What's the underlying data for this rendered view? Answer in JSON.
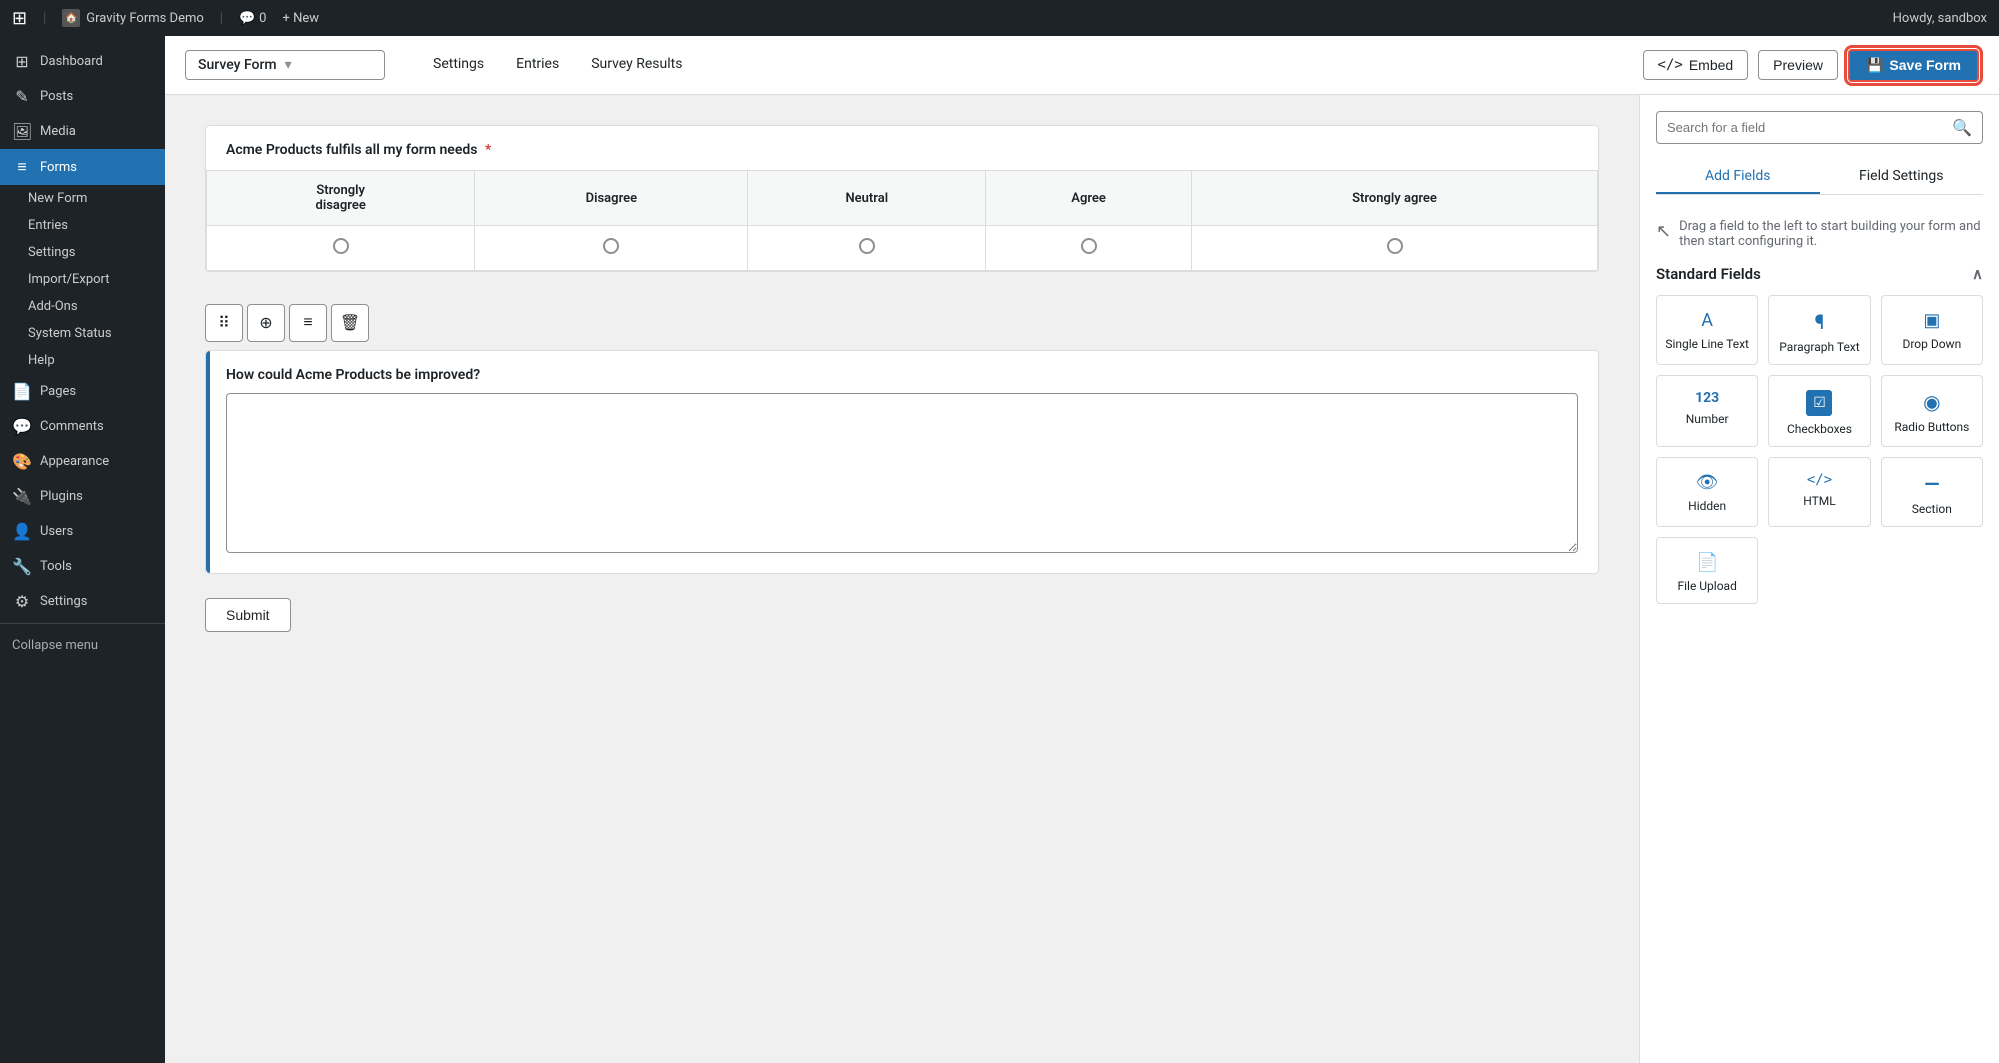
{
  "topbar": {
    "logo": "W",
    "site_name": "Gravity Forms Demo",
    "comments_count": "0",
    "new_label": "+ New",
    "greeting": "Howdy, sandbox"
  },
  "sidebar": {
    "items": [
      {
        "id": "dashboard",
        "label": "Dashboard",
        "icon": "⊞"
      },
      {
        "id": "posts",
        "label": "Posts",
        "icon": "✎"
      },
      {
        "id": "media",
        "label": "Media",
        "icon": "🖼"
      },
      {
        "id": "forms",
        "label": "Forms",
        "icon": "≡",
        "active": true
      },
      {
        "id": "pages",
        "label": "Pages",
        "icon": "📄"
      },
      {
        "id": "comments",
        "label": "Comments",
        "icon": "💬"
      },
      {
        "id": "appearance",
        "label": "Appearance",
        "icon": "🎨"
      },
      {
        "id": "plugins",
        "label": "Plugins",
        "icon": "🔌"
      },
      {
        "id": "users",
        "label": "Users",
        "icon": "👤"
      },
      {
        "id": "tools",
        "label": "Tools",
        "icon": "🔧"
      },
      {
        "id": "settings",
        "label": "Settings",
        "icon": "⚙"
      }
    ],
    "submenu_forms": [
      {
        "id": "new-form",
        "label": "New Form"
      },
      {
        "id": "entries",
        "label": "Entries"
      },
      {
        "id": "settings",
        "label": "Settings"
      },
      {
        "id": "import-export",
        "label": "Import/Export"
      },
      {
        "id": "add-ons",
        "label": "Add-Ons"
      },
      {
        "id": "system-status",
        "label": "System Status"
      },
      {
        "id": "help",
        "label": "Help"
      }
    ],
    "collapse_label": "Collapse menu"
  },
  "subheader": {
    "form_title": "Survey Form",
    "nav_items": [
      {
        "id": "settings",
        "label": "Settings"
      },
      {
        "id": "entries",
        "label": "Entries"
      },
      {
        "id": "survey-results",
        "label": "Survey Results"
      }
    ],
    "embed_label": "Embed",
    "preview_label": "Preview",
    "save_label": "Save Form"
  },
  "form_editor": {
    "question1": {
      "label": "Acme Products fulfils all my form needs",
      "required": true,
      "columns": [
        "Strongly disagree",
        "Disagree",
        "Neutral",
        "Agree",
        "Strongly agree"
      ]
    },
    "question2": {
      "label": "How could Acme Products be improved?",
      "placeholder": ""
    },
    "submit_label": "Submit",
    "toolbar": {
      "move_icon": "⋮⋮",
      "duplicate_icon": "⊕",
      "settings_icon": "≡",
      "delete_icon": "🗑"
    }
  },
  "right_panel": {
    "search_placeholder": "Search for a field",
    "tabs": [
      {
        "id": "add-fields",
        "label": "Add Fields",
        "active": true
      },
      {
        "id": "field-settings",
        "label": "Field Settings",
        "active": false
      }
    ],
    "drag_hint": "Drag a field to the left to start building your form and then start configuring it.",
    "standard_fields_label": "Standard Fields",
    "fields": [
      {
        "id": "single-line-text",
        "label": "Single Line Text",
        "icon": "A↕"
      },
      {
        "id": "paragraph-text",
        "label": "Paragraph Text",
        "icon": "¶"
      },
      {
        "id": "drop-down",
        "label": "Drop Down",
        "icon": "▣"
      },
      {
        "id": "number",
        "label": "Number",
        "icon": "123"
      },
      {
        "id": "checkboxes",
        "label": "Checkboxes",
        "icon": "☑"
      },
      {
        "id": "radio-buttons",
        "label": "Radio Buttons",
        "icon": "◉"
      },
      {
        "id": "hidden",
        "label": "Hidden",
        "icon": "👁"
      },
      {
        "id": "html",
        "label": "HTML",
        "icon": "</>"
      },
      {
        "id": "section",
        "label": "Section",
        "icon": "—"
      },
      {
        "id": "file-upload",
        "label": "File Upload",
        "icon": "📄"
      }
    ]
  }
}
